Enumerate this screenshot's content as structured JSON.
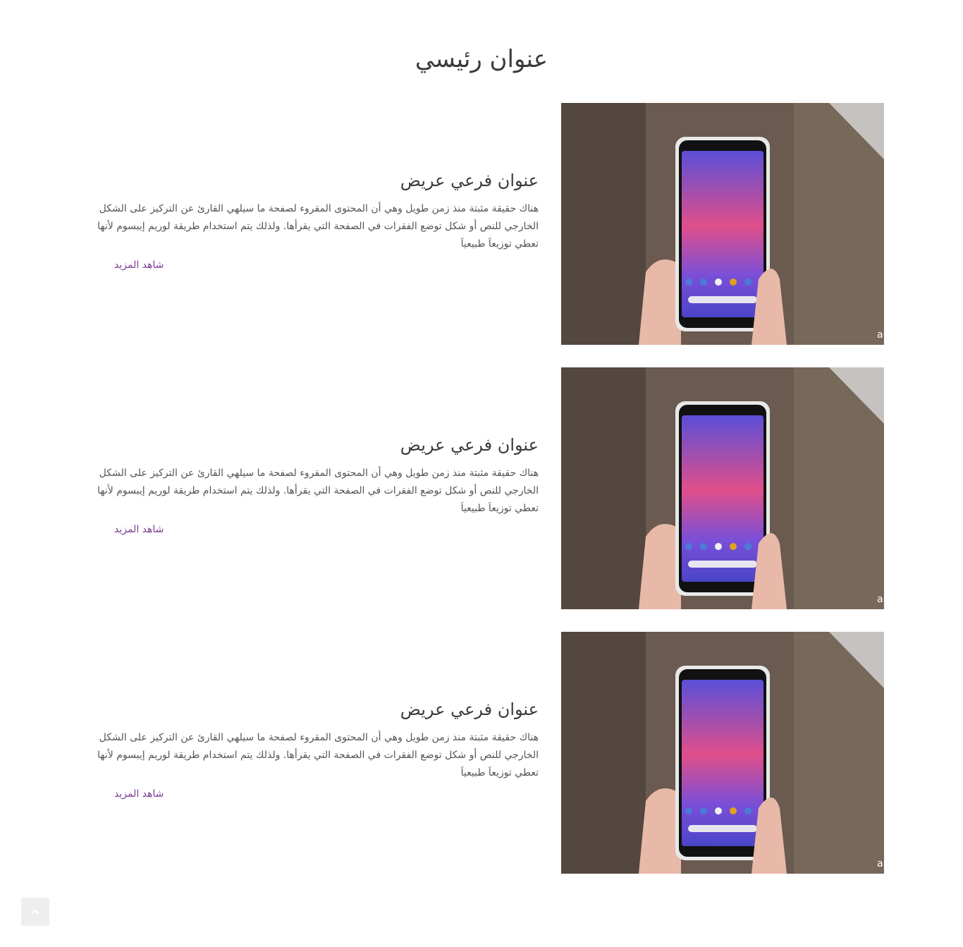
{
  "page": {
    "title": "عنوان رئيسي"
  },
  "items": [
    {
      "subtitle": "عنوان فرعي عريض",
      "body": "هناك حقيقة مثبتة منذ زمن طويل وهي أن المحتوى المقروء لصفحة ما سيلهي القارئ عن التركيز على الشكل الخارجي للنص أو شكل توضع الفقرات في الصفحة التي يقرأها. ولذلك يتم استخدام طريقة لوريم إيبسوم لأنها تعطي توزيعاَ طبيعياَ",
      "link_label": "شاهد المزيد",
      "image_watermark": "androidcentral"
    },
    {
      "subtitle": "عنوان فرعي عريض",
      "body": "هناك حقيقة مثبتة منذ زمن طويل وهي أن المحتوى المقروء لصفحة ما سيلهي القارئ عن التركيز على الشكل الخارجي للنص أو شكل توضع الفقرات في الصفحة التي يقرأها. ولذلك يتم استخدام طريقة لوريم إيبسوم لأنها تعطي توزيعاَ طبيعياَ",
      "link_label": "شاهد المزيد",
      "image_watermark": "androidcentral"
    },
    {
      "subtitle": "عنوان فرعي عريض",
      "body": "هناك حقيقة مثبتة منذ زمن طويل وهي أن المحتوى المقروء لصفحة ما سيلهي القارئ عن التركيز على الشكل الخارجي للنص أو شكل توضع الفقرات في الصفحة التي يقرأها. ولذلك يتم استخدام طريقة لوريم إيبسوم لأنها تعطي توزيعاَ طبيعياَ",
      "link_label": "شاهد المزيد",
      "image_watermark": "androidcentral"
    }
  ],
  "scroll_top": {
    "icon": "chevron-up-icon"
  },
  "colors": {
    "link": "#7a3d8f",
    "heading": "#3a3a3a",
    "body_text": "#555555"
  }
}
